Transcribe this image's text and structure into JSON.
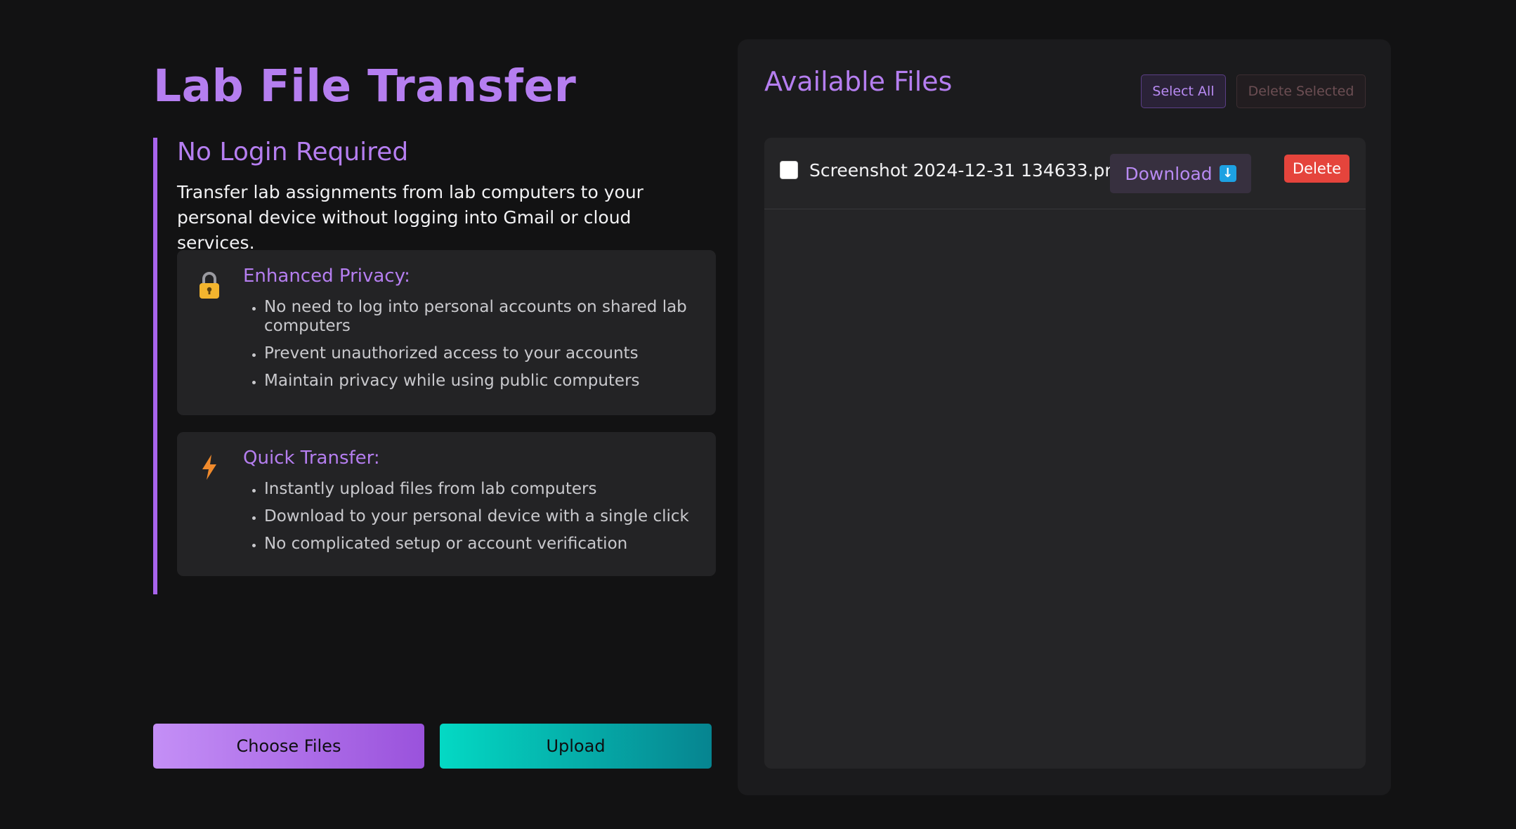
{
  "app": {
    "title": "Lab File Transfer"
  },
  "info": {
    "heading": "No Login Required",
    "description": "Transfer lab assignments from lab computers to your personal device without logging into Gmail or cloud services.",
    "features": [
      {
        "icon": "lock-icon",
        "title": "Enhanced Privacy:",
        "items": [
          "No need to log into personal accounts on shared lab computers",
          "Prevent unauthorized access to your accounts",
          "Maintain privacy while using public computers"
        ]
      },
      {
        "icon": "lightning-icon",
        "title": "Quick Transfer:",
        "items": [
          "Instantly upload files from lab computers",
          "Download to your personal device with a single click",
          "No complicated setup or account verification"
        ]
      }
    ]
  },
  "actions": {
    "choose_label": "Choose Files",
    "upload_label": "Upload"
  },
  "files_panel": {
    "title": "Available Files",
    "select_all_label": "Select All",
    "delete_selected_label": "Delete Selected",
    "files": [
      {
        "name": "Screenshot 2024-12-31 134633.png",
        "checked": false,
        "download_label": "Download",
        "download_icon": "down-arrow-icon",
        "delete_label": "Delete"
      }
    ]
  },
  "colors": {
    "background": "#121213",
    "accent": "#b57ef0",
    "upload": "#04d9c4",
    "danger": "#e5443c",
    "panel": "#1b1b1d"
  }
}
